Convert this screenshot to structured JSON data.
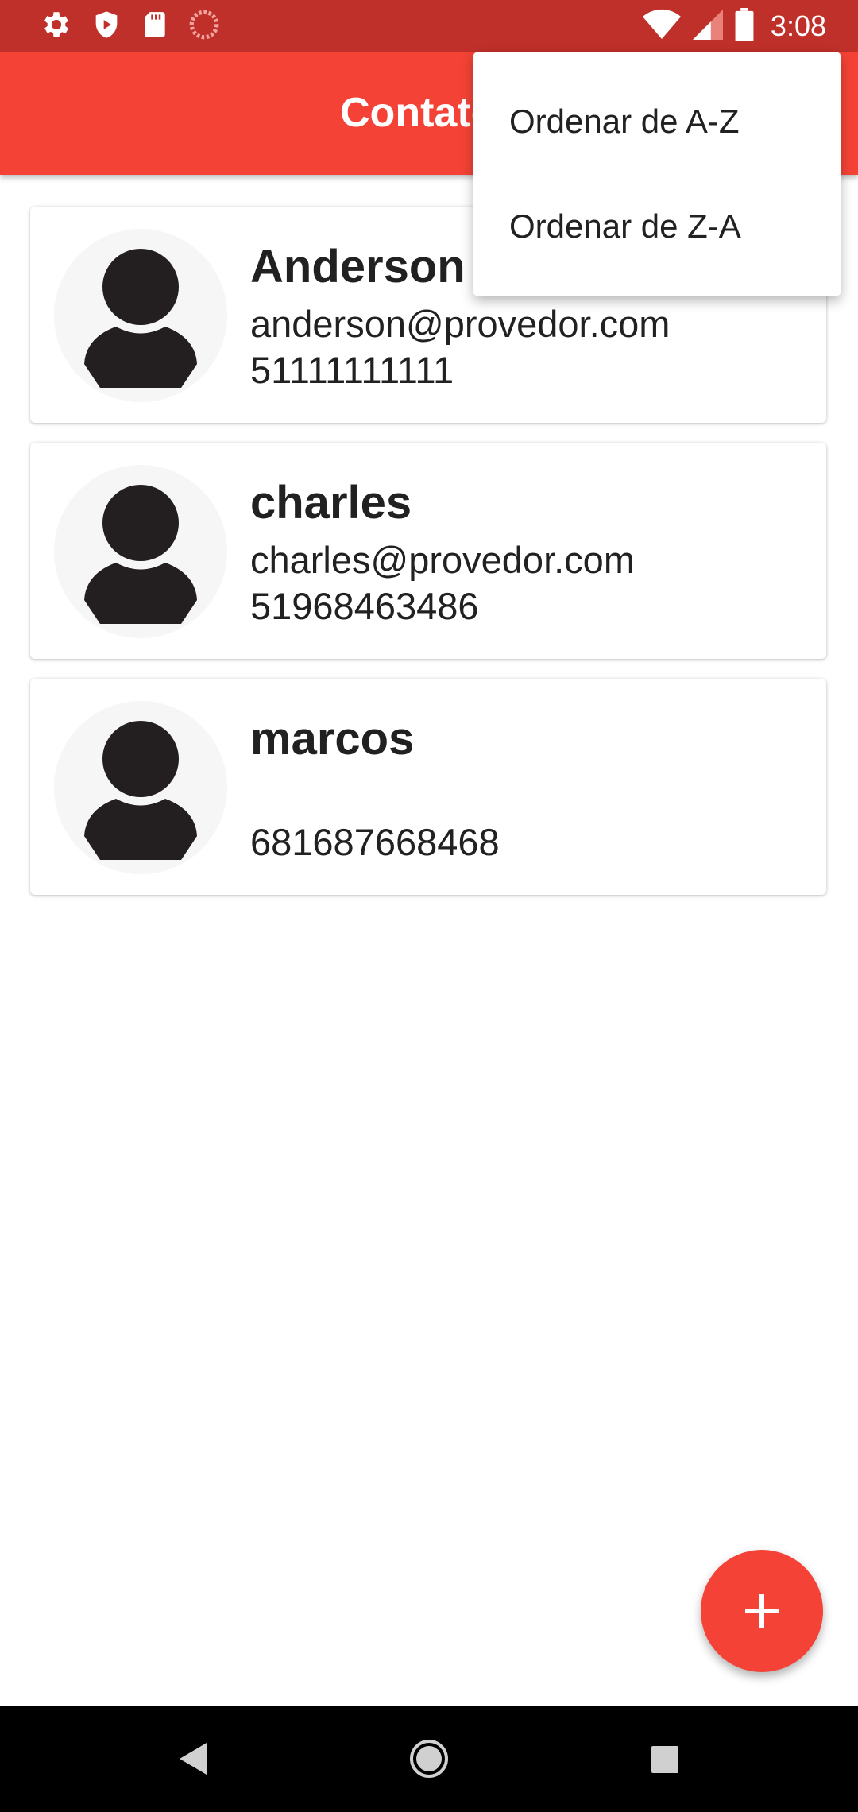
{
  "status_bar": {
    "time": "3:08",
    "left_icons": [
      "settings-icon",
      "shield-icon",
      "sd-card-icon",
      "sync-icon"
    ],
    "right_icons": [
      "wifi-icon",
      "signal-icon",
      "battery-icon"
    ]
  },
  "app_bar": {
    "title": "Contatos"
  },
  "menu": {
    "items": [
      "Ordenar de A-Z",
      "Ordenar de Z-A"
    ]
  },
  "contacts": [
    {
      "name": "Anderson",
      "email": "anderson@provedor.com",
      "phone": "51111111111"
    },
    {
      "name": "charles",
      "email": "charles@provedor.com",
      "phone": "51968463486"
    },
    {
      "name": "marcos",
      "email": "",
      "phone": "681687668468"
    }
  ],
  "fab": {
    "icon": "add-icon"
  },
  "nav_bar": {
    "icons": [
      "back-icon",
      "home-icon",
      "recents-icon"
    ]
  },
  "colors": {
    "primary": "#f44336",
    "primary_dark": "#c0302a",
    "text": "#212121"
  }
}
